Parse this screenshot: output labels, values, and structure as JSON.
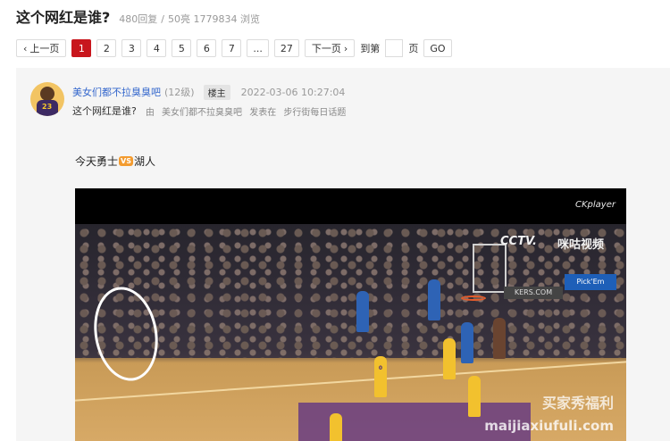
{
  "thread": {
    "title": "这个网红是谁?",
    "replies": "480回复",
    "separator": "/",
    "stats": "50亮 1779834 浏览"
  },
  "pager": {
    "prev_label": "上一页",
    "pages": [
      "1",
      "2",
      "3",
      "4",
      "5",
      "6",
      "7",
      "...",
      "27"
    ],
    "active_page": "1",
    "next_label": "下一页",
    "goto_prefix": "到第",
    "goto_suffix": "页",
    "go_label": "GO"
  },
  "post": {
    "author": "美女们都不拉臭臭吧",
    "level": "(12级)",
    "op_badge": "楼主",
    "time": "2022-03-06 10:27:04",
    "title": "这个网红是谁?",
    "by_label": "由",
    "by_author": "美女们都不拉臭臭吧",
    "posted_in": "发表在",
    "board": "步行街每日话题",
    "content_left": "今天勇士",
    "content_vs": "VS",
    "content_right": "湖人"
  },
  "video": {
    "player_label": "CKplayer",
    "broadcaster": "CCTV.",
    "broadcaster_sub": "咪咕视频",
    "ad_board": "KERS.COM",
    "pick_board": "Pick'Em",
    "watermark": "买家秀福利",
    "watermark_url": "maijiaxiufuli.com",
    "jersey_number": "0",
    "avatar_number": "23"
  },
  "colors": {
    "accent": "#c8161d",
    "link": "#3366cc",
    "post_bg": "#f5f5f5"
  }
}
